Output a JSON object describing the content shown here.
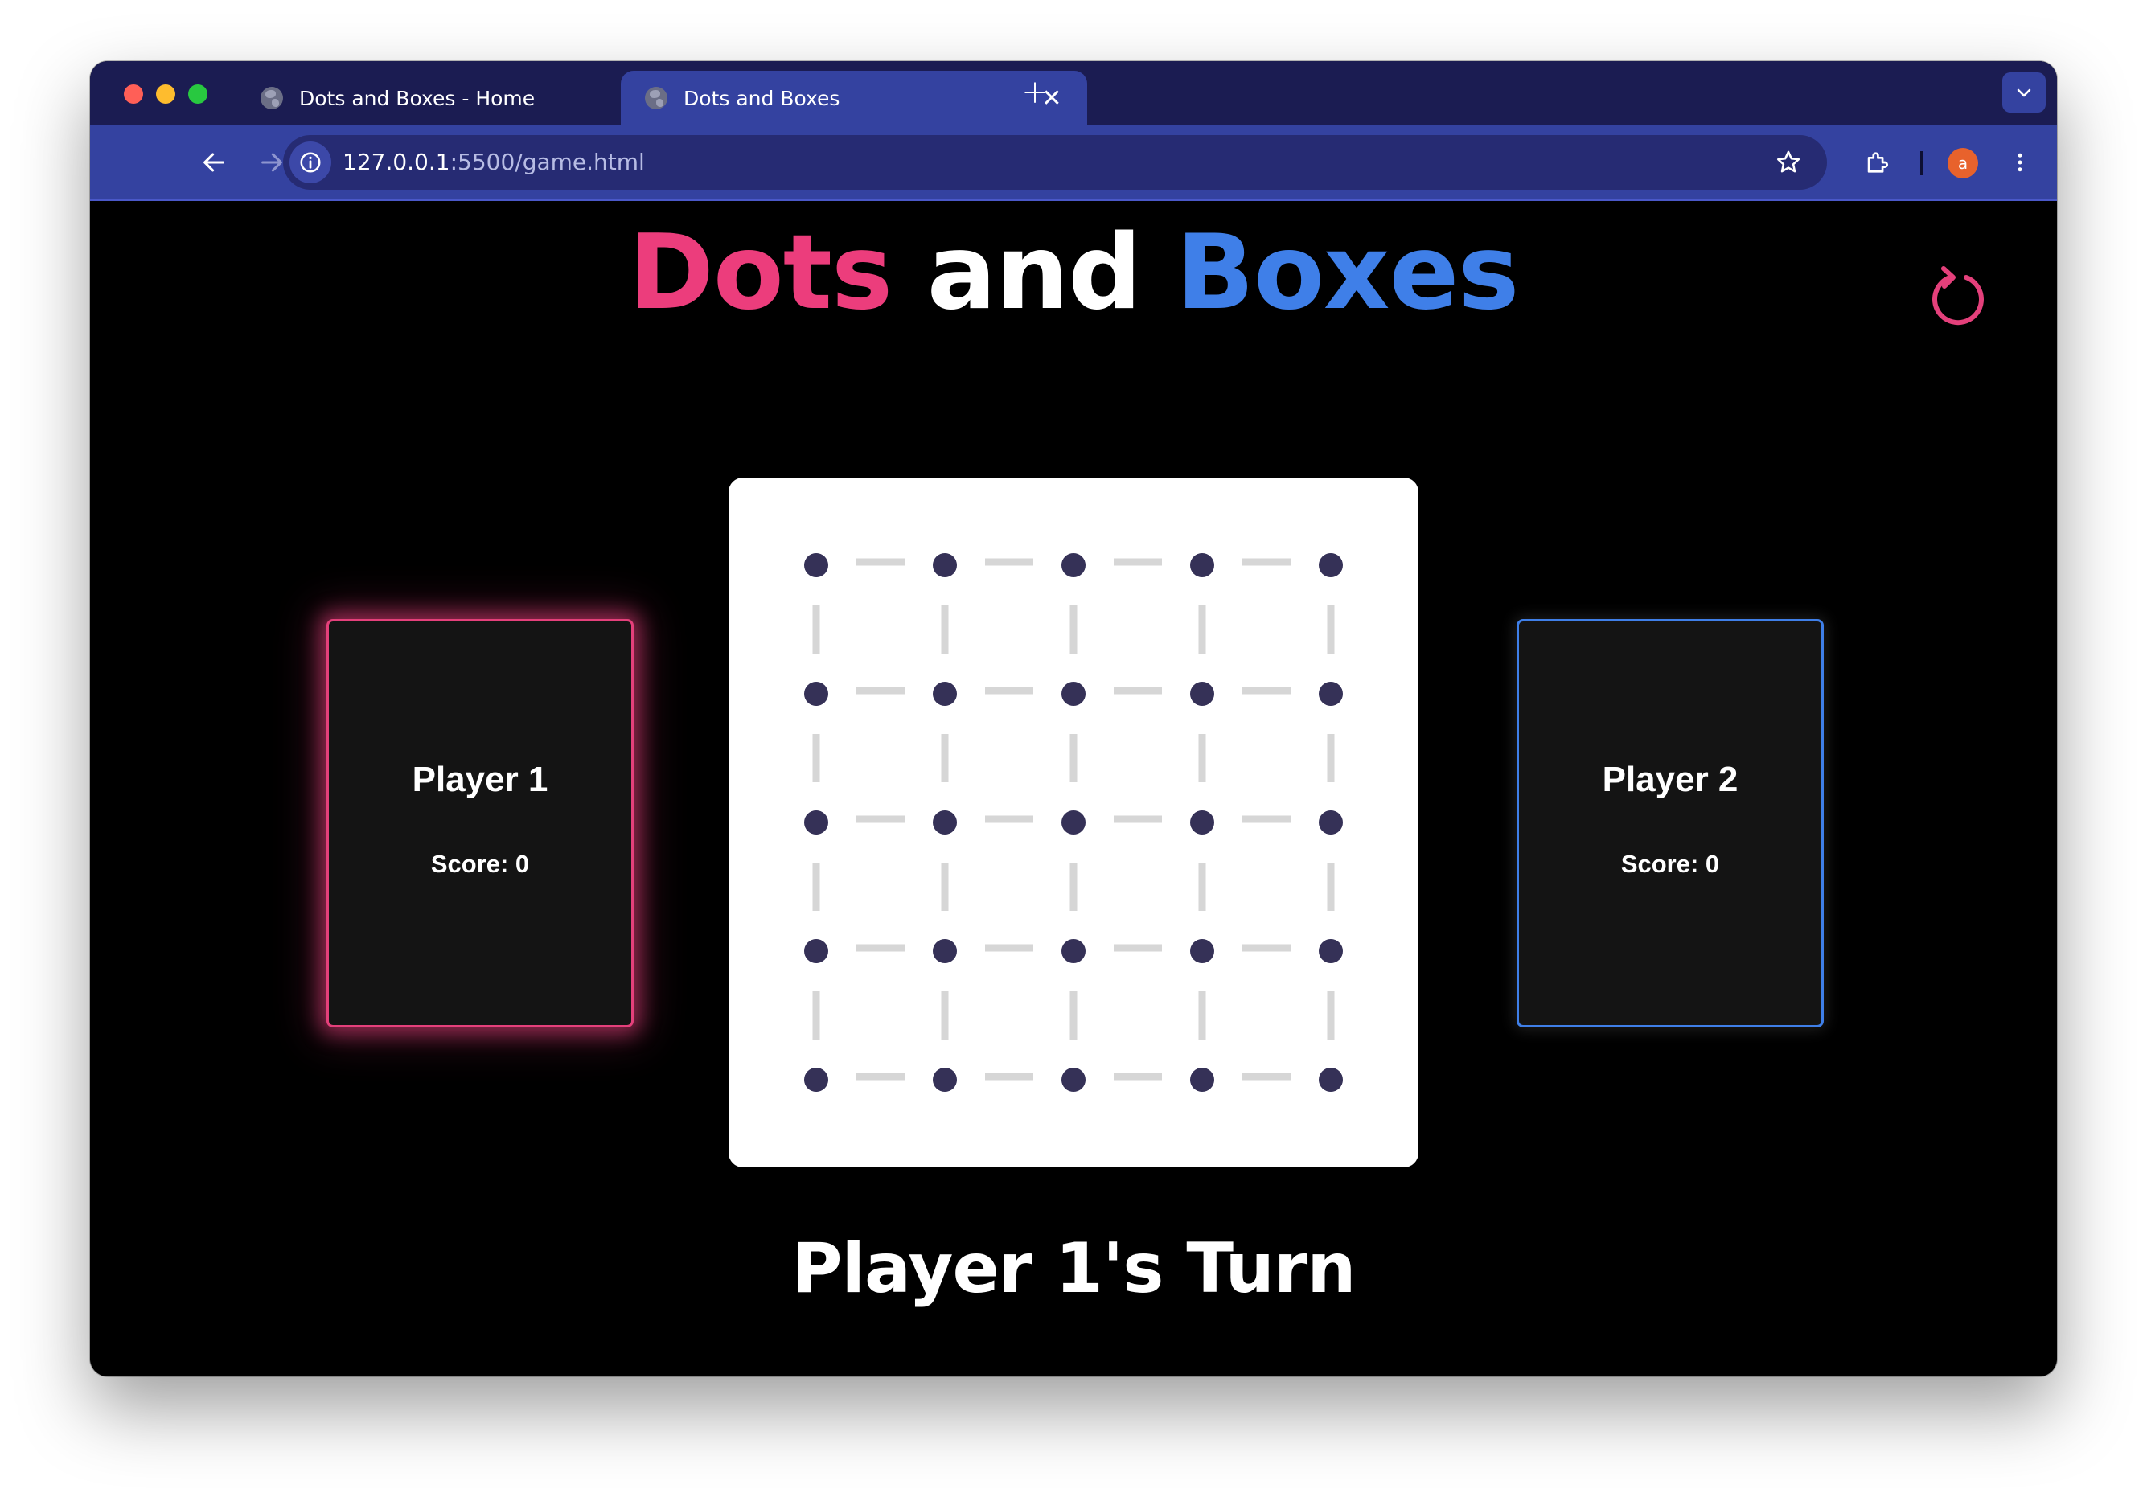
{
  "browser": {
    "tabs": [
      {
        "title": "Dots and Boxes - Home",
        "active": false
      },
      {
        "title": "Dots and Boxes",
        "active": true
      }
    ],
    "address": {
      "host": "127.0.0.1",
      "path": ":5500/game.html"
    },
    "profile_initial": "a"
  },
  "game": {
    "title_words": [
      "Dots",
      "and",
      "Boxes"
    ],
    "players": [
      {
        "name": "Player 1",
        "score_text": "Score: 0",
        "color": "#e4407b"
      },
      {
        "name": "Player 2",
        "score_text": "Score: 0",
        "color": "#3f7fe8"
      }
    ],
    "turn_text": "Player 1's Turn",
    "board": {
      "dots_per_side": 5,
      "dot_color": "#353157",
      "line_color": "#d6d6d6"
    }
  },
  "colors": {
    "accent_pink": "#ec3d7c",
    "accent_blue": "#3f7fe8",
    "tab_strip": "#1b1c52",
    "toolbar": "#3442a0"
  },
  "icons": [
    "globe-icon",
    "close-icon",
    "plus-icon",
    "chevron-down-icon",
    "back-arrow-icon",
    "forward-arrow-icon",
    "reload-icon",
    "info-icon",
    "star-icon",
    "extensions-icon",
    "more-vert-icon",
    "restart-icon"
  ]
}
